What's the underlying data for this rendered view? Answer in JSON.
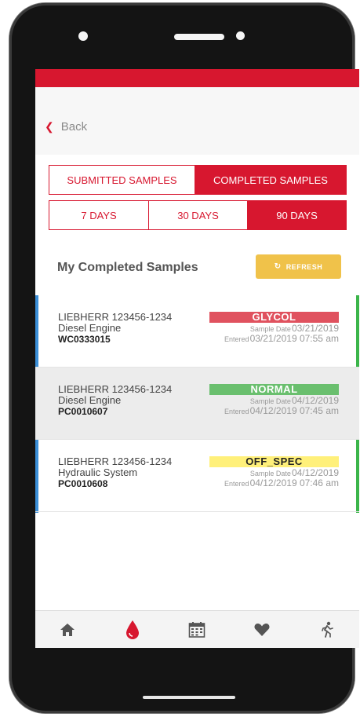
{
  "nav": {
    "back_label": "Back"
  },
  "sample_type_tabs": [
    {
      "label": "SUBMITTED SAMPLES",
      "active": false
    },
    {
      "label": "COMPLETED SAMPLES",
      "active": true
    }
  ],
  "range_tabs": [
    {
      "label": "7 DAYS",
      "active": false
    },
    {
      "label": "30 DAYS",
      "active": false
    },
    {
      "label": "90 DAYS",
      "active": true
    }
  ],
  "section": {
    "title": "My Completed Samples",
    "refresh_label": "REFRESH"
  },
  "samples": [
    {
      "equipment": "LIEBHERR 123456-1234",
      "component": "Diesel Engine",
      "sample_id": "WC0333015",
      "status": "GLYCOL",
      "sample_date_label": "Sample Date",
      "sample_date": "03/21/2019",
      "entered_label": "Entered",
      "entered": "03/21/2019 07:55 am"
    },
    {
      "equipment": "LIEBHERR 123456-1234",
      "component": "Diesel Engine",
      "sample_id": "PC0010607",
      "status": "NORMAL",
      "sample_date_label": "Sample Date",
      "sample_date": "04/12/2019",
      "entered_label": "Entered",
      "entered": "04/12/2019 07:45 am"
    },
    {
      "equipment": "LIEBHERR 123456-1234",
      "component": "Hydraulic System",
      "sample_id": "PC0010608",
      "status": "OFF_SPEC",
      "sample_date_label": "Sample Date",
      "sample_date": "04/12/2019",
      "entered_label": "Entered",
      "entered": "04/12/2019 07:46 am"
    }
  ],
  "tab_bar": [
    {
      "icon": "home-icon",
      "active": false
    },
    {
      "icon": "oil-drop-icon",
      "active": true
    },
    {
      "icon": "calendar-icon",
      "active": false
    },
    {
      "icon": "heart-icon",
      "active": false
    },
    {
      "icon": "running-person-icon",
      "active": false
    }
  ],
  "colors": {
    "brand_red": "#d7172f",
    "refresh_yellow": "#f0c24a",
    "glycol_red": "#e0525f",
    "normal_green": "#6abf6e",
    "offspec_yellow": "#fff07a",
    "left_accent_blue": "#3b8fd8",
    "right_accent_green": "#3bb54a"
  }
}
